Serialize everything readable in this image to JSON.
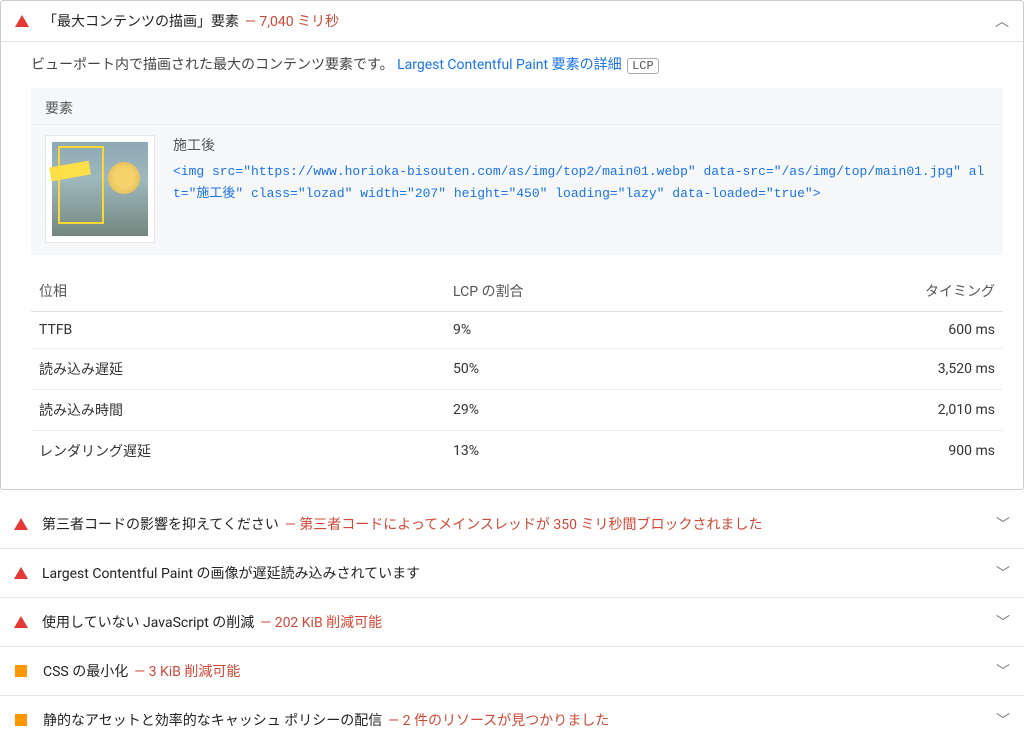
{
  "expanded": {
    "title": "「最大コンテンツの描画」要素",
    "metric": "— 7,040 ミリ秒",
    "description_prefix": "ビューポート内で描画された最大のコンテンツ要素です。",
    "link_text": "Largest Contentful Paint 要素の詳細",
    "badge": "LCP",
    "element_header": "要素",
    "element_label": "施工後",
    "code": "<img src=\"https://www.horioka-bisouten.com/as/img/top2/main01.webp\" data-src=\"/as/img/top/main01.jpg\" alt=\"施工後\" class=\"lozad\" width=\"207\" height=\"450\" loading=\"lazy\" data-loaded=\"true\">",
    "table_headers": {
      "phase": "位相",
      "pct": "LCP の割合",
      "timing": "タイミング"
    },
    "rows": [
      {
        "phase": "TTFB",
        "pct": "9%",
        "timing": "600 ms"
      },
      {
        "phase": "読み込み遅延",
        "pct": "50%",
        "timing": "3,520 ms"
      },
      {
        "phase": "読み込み時間",
        "pct": "29%",
        "timing": "2,010 ms"
      },
      {
        "phase": "レンダリング遅延",
        "pct": "13%",
        "timing": "900 ms"
      }
    ]
  },
  "collapsed": [
    {
      "icon": "tri-red",
      "title": "第三者コードの影響を抑えてください",
      "metric": "— 第三者コードによってメインスレッドが 350 ミリ秒間ブロックされました"
    },
    {
      "icon": "tri-red",
      "title": "Largest Contentful Paint の画像が遅延読み込みされています",
      "metric": ""
    },
    {
      "icon": "tri-red",
      "title": "使用していない JavaScript の削減",
      "metric": "— 202 KiB 削減可能"
    },
    {
      "icon": "sq-orange",
      "title": "CSS の最小化",
      "metric": "— 3 KiB 削減可能"
    },
    {
      "icon": "sq-orange",
      "title": "静的なアセットと効率的なキャッシュ ポリシーの配信",
      "metric": "— 2 件のリソースが見つかりました"
    }
  ]
}
